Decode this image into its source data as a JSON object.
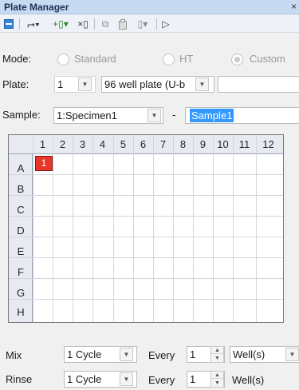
{
  "window": {
    "title": "Plate Manager",
    "close_glyph": "×"
  },
  "toolbar": {
    "items": [
      {
        "name": "layout-icon",
        "glyph": "▬"
      },
      {
        "name": "insert-row-icon",
        "glyph": "⮣▾"
      },
      {
        "name": "add-well-icon",
        "glyph": "+▯▾"
      },
      {
        "name": "remove-well-icon",
        "glyph": "×▯"
      },
      {
        "name": "copy-icon",
        "glyph": "⧉"
      },
      {
        "name": "paste-icon",
        "glyph": "📋"
      },
      {
        "name": "select-icon",
        "glyph": "▯▾"
      },
      {
        "name": "play-icon",
        "glyph": "▷"
      }
    ]
  },
  "mode": {
    "label": "Mode:",
    "options": [
      "Standard",
      "HT",
      "Custom"
    ],
    "selected": "Custom"
  },
  "plate": {
    "label": "Plate:",
    "number": "1",
    "type": "96 well plate (U-b",
    "extra_value": ""
  },
  "sample": {
    "label": "Sample:",
    "selected": "1:Specimen1",
    "dash": "-",
    "name": "Sample1"
  },
  "grid": {
    "columns": [
      "1",
      "2",
      "3",
      "4",
      "5",
      "6",
      "7",
      "8",
      "9",
      "10",
      "11",
      "12"
    ],
    "rows": [
      "A",
      "B",
      "C",
      "D",
      "E",
      "F",
      "G",
      "H"
    ],
    "filled_cell": {
      "row": "A",
      "col": "1",
      "text": "1"
    }
  },
  "mix": {
    "label": "Mix",
    "cycle": "1 Cycle",
    "every_label": "Every",
    "count": "1",
    "unit": "Well(s)"
  },
  "rinse": {
    "label": "Rinse",
    "cycle": "1 Cycle",
    "every_label": "Every",
    "count": "1",
    "unit": "Well(s)"
  },
  "colors": {
    "filled_well": "#e8372a",
    "selection": "#3399ff",
    "title_bar": "#c8daf1"
  }
}
